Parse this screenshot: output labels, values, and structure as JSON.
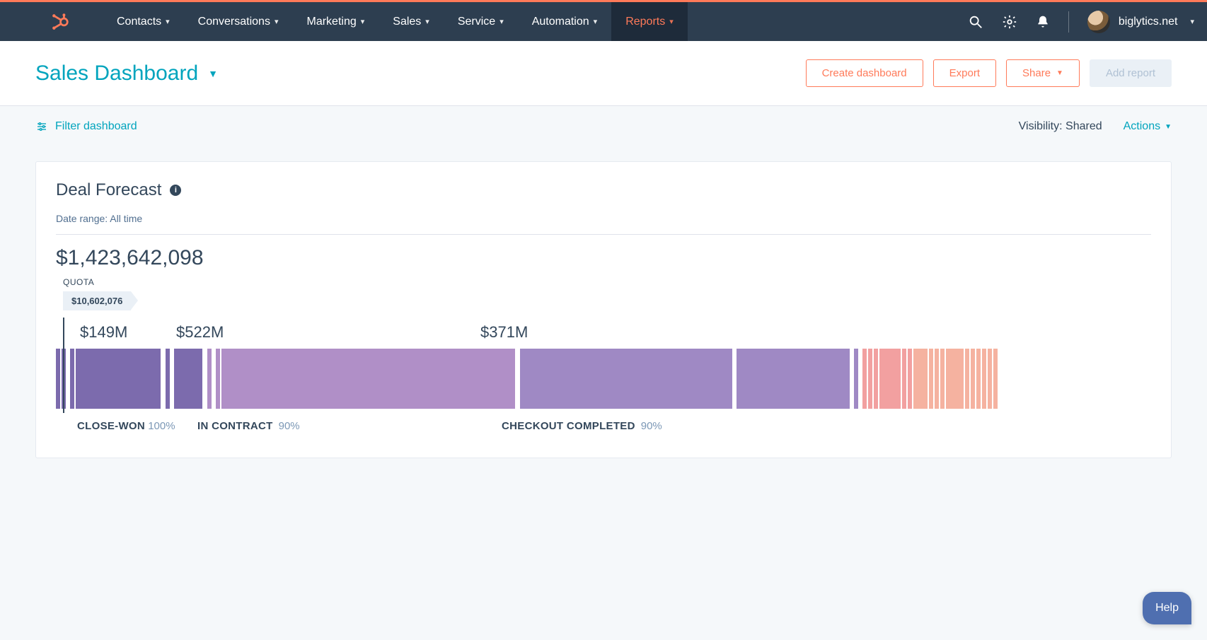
{
  "nav": {
    "items": [
      "Contacts",
      "Conversations",
      "Marketing",
      "Sales",
      "Service",
      "Automation",
      "Reports"
    ],
    "active_index": 6,
    "account": "biglytics.net"
  },
  "header": {
    "title": "Sales Dashboard",
    "buttons": {
      "create": "Create dashboard",
      "export": "Export",
      "share": "Share",
      "add": "Add report"
    }
  },
  "subbar": {
    "filter": "Filter dashboard",
    "visibility_label": "Visibility:",
    "visibility_value": "Shared",
    "actions": "Actions"
  },
  "forecast": {
    "title": "Deal Forecast",
    "date_range_label": "Date range:",
    "date_range_value": "All time",
    "total": "$1,423,642,098",
    "quota_label": "QUOTA",
    "quota_value": "$10,602,076",
    "stages": [
      {
        "name": "CLOSE-WON",
        "percent": "100%",
        "value": "$149M"
      },
      {
        "name": "IN CONTRACT",
        "percent": "90%",
        "value": "$522M"
      },
      {
        "name": "CHECKOUT COMPLETED",
        "percent": "90%",
        "value": "$371M"
      }
    ]
  },
  "chart_data": {
    "type": "bar",
    "title": "Deal Forecast",
    "total": 1423642098,
    "quota": 10602076,
    "series": [
      {
        "name": "CLOSE-WON",
        "percent": 100,
        "value_label": "$149M",
        "value": 149000000
      },
      {
        "name": "IN CONTRACT",
        "percent": 90,
        "value_label": "$522M",
        "value": 522000000
      },
      {
        "name": "CHECKOUT COMPLETED",
        "percent": 90,
        "value_label": "$371M",
        "value": 371000000
      }
    ]
  },
  "help": "Help"
}
